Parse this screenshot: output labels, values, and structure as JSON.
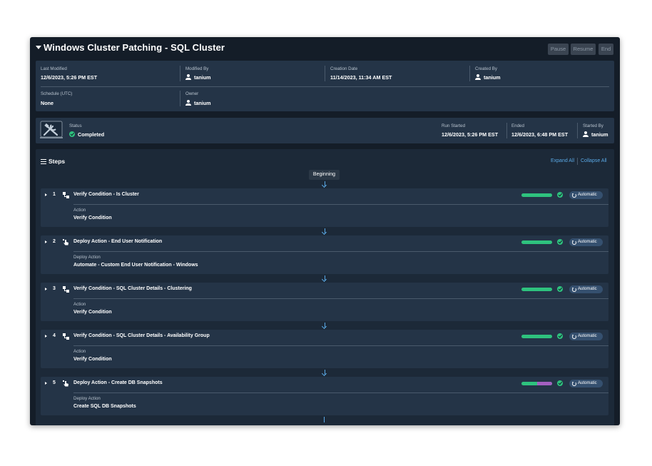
{
  "header": {
    "title": "Windows Cluster Patching - SQL Cluster",
    "buttons": {
      "pause": "Pause",
      "resume": "Resume",
      "end": "End"
    }
  },
  "details": {
    "last_modified": {
      "label": "Last Modified",
      "value": "12/6/2023, 5:26 PM EST"
    },
    "modified_by": {
      "label": "Modified By",
      "value": "tanium"
    },
    "creation_date": {
      "label": "Creation Date",
      "value": "11/14/2023, 11:34 AM EST"
    },
    "created_by": {
      "label": "Created By",
      "value": "tanium"
    },
    "schedule": {
      "label": "Schedule (UTC)",
      "value": "None"
    },
    "owner": {
      "label": "Owner",
      "value": "tanium"
    }
  },
  "status": {
    "status": {
      "label": "Status",
      "value": "Completed"
    },
    "run_started": {
      "label": "Run Started",
      "value": "12/6/2023, 5:26 PM EST"
    },
    "ended": {
      "label": "Ended",
      "value": "12/6/2023, 6:48 PM EST"
    },
    "started_by": {
      "label": "Started By",
      "value": "tanium"
    },
    "colors": {
      "success": "#2ec27e",
      "in_progress": "#a35fc0",
      "link": "#5aa9e6"
    }
  },
  "steps": {
    "title": "Steps",
    "expand_all": "Expand All",
    "collapse_all": "Collapse All",
    "beginning": "Beginning",
    "items": [
      {
        "num": "1",
        "icon": "condition-icon",
        "title": "Verify Condition - Is Cluster",
        "label": "Action",
        "value": "Verify Condition",
        "mode": "Automatic",
        "progress_complete": 1.0
      },
      {
        "num": "2",
        "icon": "action-icon",
        "title": "Deploy Action - End User Notification",
        "label": "Deploy Action",
        "value": "Automate - Custom End User Notification - Windows",
        "mode": "Automatic",
        "progress_complete": 1.0
      },
      {
        "num": "3",
        "icon": "condition-icon",
        "title": "Verify Condition - SQL Cluster Details - Clustering",
        "label": "Action",
        "value": "Verify Condition",
        "mode": "Automatic",
        "progress_complete": 1.0
      },
      {
        "num": "4",
        "icon": "condition-icon",
        "title": "Verify Condition - SQL Cluster Details - Availability Group",
        "label": "Action",
        "value": "Verify Condition",
        "mode": "Automatic",
        "progress_complete": 1.0
      },
      {
        "num": "5",
        "icon": "action-icon",
        "title": "Deploy Action - Create DB Snapshots",
        "label": "Deploy Action",
        "value": "Create SQL DB Snapshots",
        "mode": "Automatic",
        "progress_complete": 0.5
      }
    ]
  }
}
